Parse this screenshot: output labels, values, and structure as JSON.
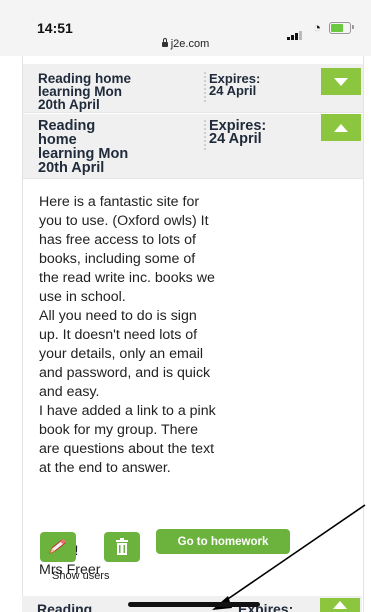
{
  "status": {
    "time": "14:51",
    "url": "j2e.com"
  },
  "rows": [
    {
      "title": "Reading home\nlearning Mon\n20th April",
      "expires": "Expires:\n24 April",
      "expanded": false
    },
    {
      "title": "Reading\nhome\nlearning Mon\n20th April",
      "expires": "Expires:\n24 April",
      "expanded": true
    }
  ],
  "message": {
    "body": "Here is a fantastic site for\nyou to use. (Oxford owls) It\nhas free access to lots of\nbooks, including some of\nthe read write inc. books we\nuse in school.\nAll you need to do is sign\nup. It doesn't need lots of\nyour details, only an email\nand password, and is quick\nand easy.\nI have added a link to a pink\nbook for my group. There\nare questions about the text\nat the end to answer.",
    "signoff": "Enjoy!\nMrs Freer"
  },
  "actions": {
    "edit_icon": "pencil-icon",
    "delete_icon": "trash-icon",
    "go_label": "Go to homework",
    "show_users_label": "Show users"
  },
  "next_row": {
    "title": "Reading",
    "expires": "Expires:"
  },
  "colors": {
    "accent_green": "#8cc63f",
    "button_green": "#6cb33e",
    "row_bg": "#f0f0f0",
    "title_text": "#1f2a3a"
  }
}
